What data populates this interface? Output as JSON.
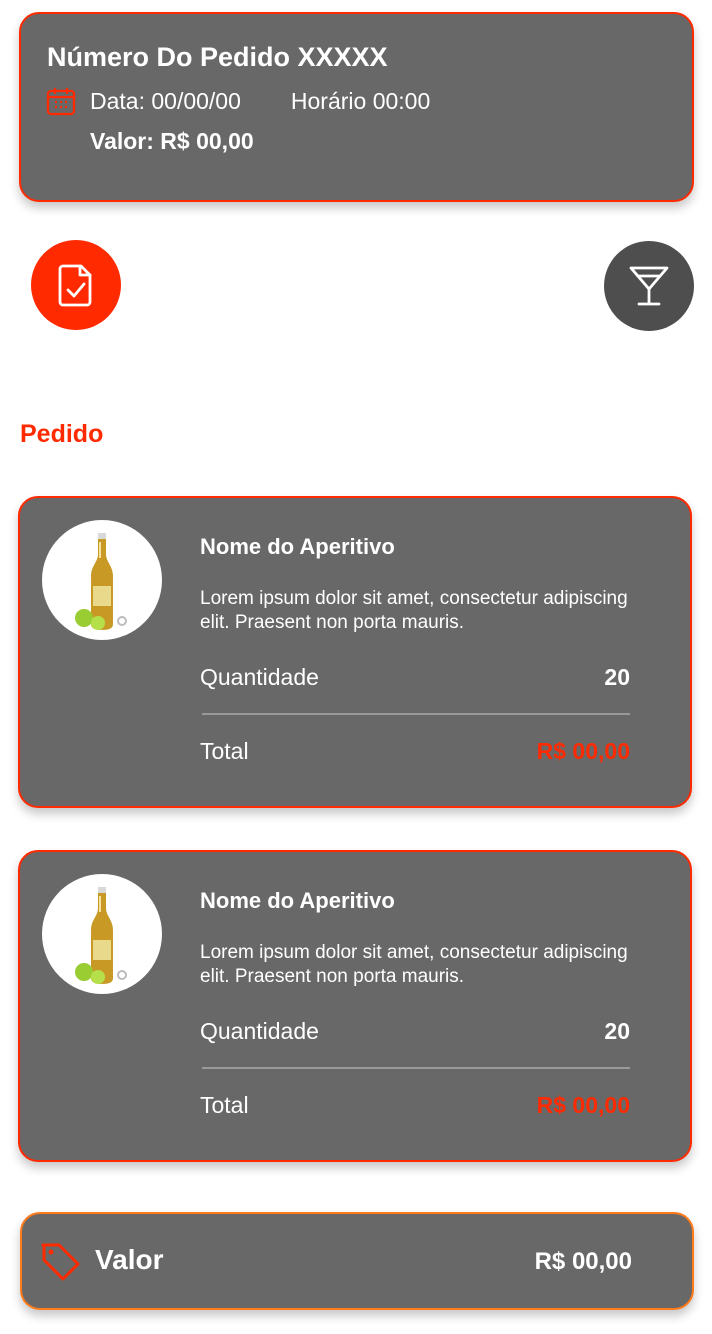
{
  "order": {
    "title": "Número Do Pedido XXXXX",
    "date": "Data: 00/00/00",
    "time": "Horário 00:00",
    "value": "Valor: R$ 00,00"
  },
  "actions": {
    "order_icon": "document-check-icon",
    "drinks_icon": "cocktail-glass-icon"
  },
  "section": {
    "title": "Pedido"
  },
  "items": [
    {
      "name": "Nome do Aperitivo",
      "description": "Lorem ipsum dolor sit amet, consectetur adipiscing elit. Praesent non porta mauris.",
      "quantity_label": "Quantidade",
      "quantity": "20",
      "total_label": "Total",
      "total": "R$ 00,00",
      "image_icon": "beer-bottle-icon"
    },
    {
      "name": "Nome do Aperitivo",
      "description": "Lorem ipsum dolor sit amet, consectetur adipiscing elit. Praesent non porta mauris.",
      "quantity_label": "Quantidade",
      "quantity": "20",
      "total_label": "Total",
      "total": "R$ 00,00",
      "image_icon": "beer-bottle-icon"
    }
  ],
  "footer": {
    "label": "Valor",
    "value": "R$ 00,00",
    "icon": "price-tag-icon"
  },
  "colors": {
    "accent": "#ff2a00",
    "card": "#686868",
    "dark_button": "#4e4e4e",
    "footer_border": "#ff7a1a"
  }
}
